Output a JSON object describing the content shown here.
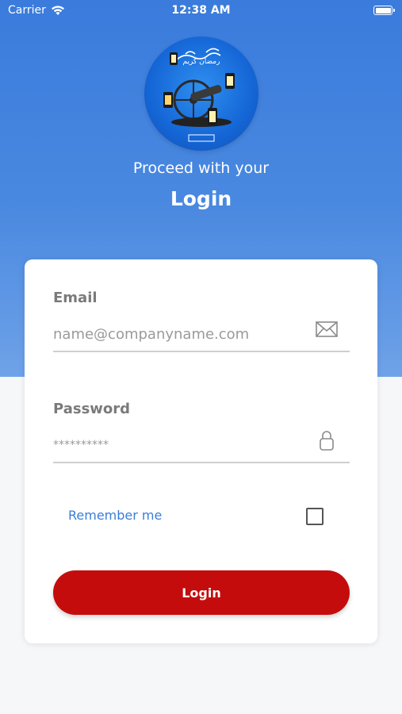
{
  "status_bar": {
    "carrier": "Carrier",
    "time": "12:38 AM"
  },
  "header": {
    "logo_text": "رمضان كريم",
    "subtitle": "Proceed with your",
    "title": "Login"
  },
  "form": {
    "email_label": "Email",
    "email_placeholder": "name@companyname.com",
    "password_label": "Password",
    "password_value": "**********",
    "remember_label": "Remember me",
    "remember_checked": false,
    "login_button": "Login"
  },
  "colors": {
    "hero_blue": "#3a7bdc",
    "login_red": "#c40c0c",
    "link_blue": "#3b7dd8"
  },
  "icons": {
    "email": "envelope-icon",
    "password": "lock-icon",
    "wifi": "wifi-icon",
    "battery": "battery-icon"
  }
}
